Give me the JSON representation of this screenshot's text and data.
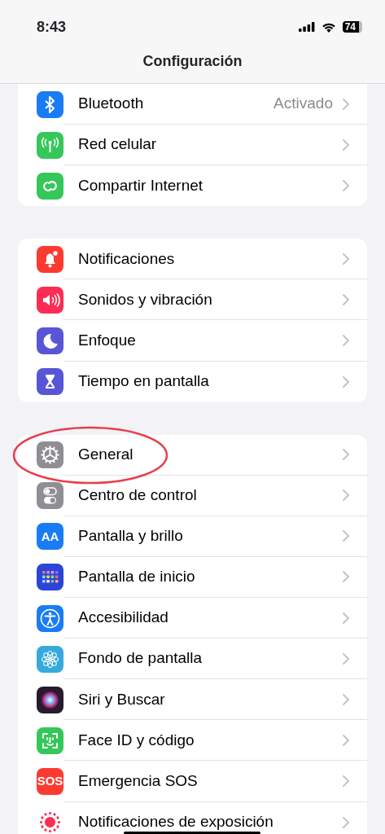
{
  "status_bar": {
    "time": "8:43",
    "battery": "74"
  },
  "nav": {
    "title": "Configuración"
  },
  "groups": [
    {
      "cut_top": true,
      "items": [
        {
          "label": "Bluetooth",
          "value": "Activado",
          "kind": "bluetooth",
          "color": "#1a7cf5"
        },
        {
          "label": "Red celular",
          "kind": "antenna",
          "color": "#35c759"
        },
        {
          "label": "Compartir Internet",
          "kind": "link",
          "color": "#35c759"
        }
      ]
    },
    {
      "cut_top": false,
      "items": [
        {
          "label": "Notificaciones",
          "kind": "bell",
          "color": "#fb3b30"
        },
        {
          "label": "Sonidos y vibración",
          "kind": "speaker",
          "color": "#fb2d55"
        },
        {
          "label": "Enfoque",
          "kind": "moon",
          "color": "#5856d6"
        },
        {
          "label": "Tiempo en pantalla",
          "kind": "hourglass",
          "color": "#5856d6"
        }
      ]
    },
    {
      "cut_top": false,
      "items": [
        {
          "label": "General",
          "kind": "gear",
          "color": "#8e8e93",
          "circled": true
        },
        {
          "label": "Centro de control",
          "kind": "toggles",
          "color": "#8e8e93"
        },
        {
          "label": "Pantalla y brillo",
          "kind": "text",
          "icon_text": "AA",
          "color": "#1a7cf5"
        },
        {
          "label": "Pantalla de inicio",
          "kind": "grid",
          "color": "#2a45d8"
        },
        {
          "label": "Accesibilidad",
          "kind": "accessibility",
          "color": "#1a7cf5"
        },
        {
          "label": "Fondo de pantalla",
          "kind": "flower",
          "color": "#36aadc"
        },
        {
          "label": "Siri y Buscar",
          "kind": "orb",
          "color": "#2a1a2e"
        },
        {
          "label": "Face ID y código",
          "kind": "face",
          "color": "#35c759"
        },
        {
          "label": "Emergencia SOS",
          "kind": "text",
          "icon_text": "SOS",
          "color": "#fb3b30"
        },
        {
          "label": "Notificaciones de exposición",
          "kind": "sun",
          "color": "#fb2d55"
        }
      ]
    }
  ]
}
